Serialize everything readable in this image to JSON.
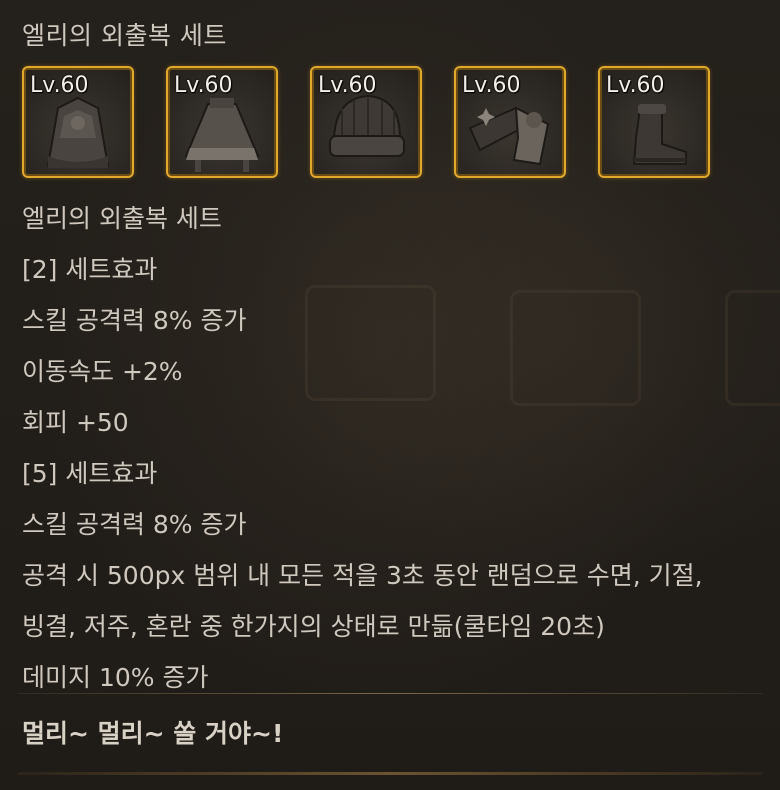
{
  "set": {
    "title": "엘리의 외출복 세트",
    "items": [
      {
        "level": "Lv.60",
        "icon": "dress-coat-icon"
      },
      {
        "level": "Lv.60",
        "icon": "skirt-icon"
      },
      {
        "level": "Lv.60",
        "icon": "hat-icon"
      },
      {
        "level": "Lv.60",
        "icon": "gloves-icon"
      },
      {
        "level": "Lv.60",
        "icon": "boots-icon"
      }
    ]
  },
  "description": {
    "lines": [
      "엘리의 외출복 세트",
      "[2] 세트효과",
      "스킬 공격력 8% 증가",
      "이동속도 +2%",
      "회피 +50",
      "[5] 세트효과",
      "스킬 공격력 8% 증가",
      "공격 시 500px 범위 내 모든 적을 3초 동안 랜덤으로 수면, 기절,",
      "빙결, 저주, 혼란 중 한가지의 상태로 만듦(쿨타임 20초)",
      "데미지 10% 증가"
    ],
    "flavor": "멀리~ 멀리~ 쏠 거야~!"
  },
  "colors": {
    "frame": "#e0a92c",
    "background": "#211d19",
    "text": "#cfc8be"
  }
}
